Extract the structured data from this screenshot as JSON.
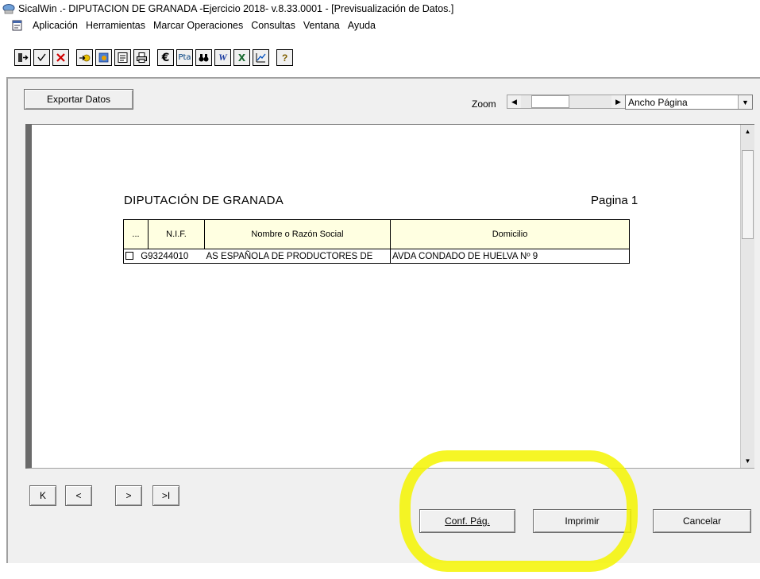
{
  "window": {
    "title": "SicalWin  .- DIPUTACION DE GRANADA -Ejercicio 2018- v.8.33.0001 - [Previsualización de Datos.]"
  },
  "menu": {
    "items": [
      "Aplicación",
      "Herramientas",
      "Marcar Operaciones",
      "Consultas",
      "Ventana",
      "Ayuda"
    ]
  },
  "toolbar": {
    "buttons": [
      {
        "icon": "exit-icon",
        "glyph": "⇥"
      },
      {
        "icon": "check-icon",
        "glyph": "✓"
      },
      {
        "icon": "cancel-x-icon",
        "glyph": "✕"
      },
      {
        "icon": "new-record-icon",
        "glyph": "➜"
      },
      {
        "icon": "find-record-icon",
        "glyph": "◉"
      },
      {
        "icon": "list-icon",
        "glyph": "▤"
      },
      {
        "icon": "print-icon",
        "glyph": "⎙"
      },
      {
        "icon": "euro-icon",
        "glyph": "€"
      },
      {
        "icon": "pesetas-icon",
        "glyph": "Pta"
      },
      {
        "icon": "binoculars-icon",
        "glyph": "⚲"
      },
      {
        "icon": "word-icon",
        "glyph": "W"
      },
      {
        "icon": "excel-icon",
        "glyph": "X"
      },
      {
        "icon": "chart-icon",
        "glyph": "⊿"
      },
      {
        "icon": "help-icon",
        "glyph": "?"
      }
    ]
  },
  "controls": {
    "export_label": "Exportar Datos",
    "zoom_label": "Zoom",
    "zoom_value": "Ancho Página"
  },
  "document": {
    "title": "DIPUTACIÓN DE GRANADA",
    "page_label": "Pagina 1",
    "columns": [
      "...",
      "N.I.F.",
      "Nombre o Razón Social",
      "Domicilio"
    ],
    "rows": [
      {
        "nif": "G93244010",
        "nombre": "AS ESPAÑOLA DE PRODUCTORES DE",
        "domicilio": "AVDA CONDADO DE HUELVA Nº 9"
      }
    ]
  },
  "navigation": {
    "first": "K",
    "prev": "<",
    "next": ">",
    "last": ">I"
  },
  "actions": {
    "page_setup": "Conf. Pág.",
    "print": "Imprimir",
    "cancel": "Cancelar"
  },
  "colors": {
    "highlight": "#f5f500",
    "header_fill": "#ffffe1"
  }
}
